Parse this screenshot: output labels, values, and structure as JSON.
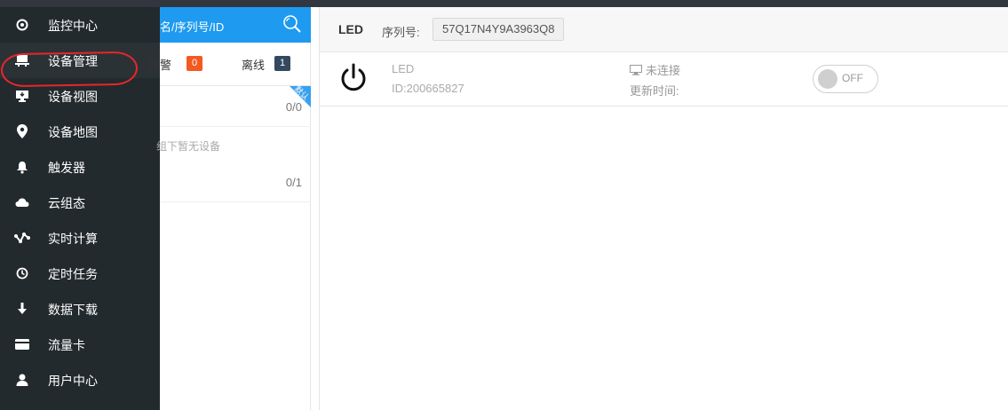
{
  "sidebar": {
    "items": [
      {
        "label": "监控中心",
        "icon": "target-icon"
      },
      {
        "label": "设备管理",
        "icon": "desk-icon"
      },
      {
        "label": "设备视图",
        "icon": "monitor-icon"
      },
      {
        "label": "设备地图",
        "icon": "map-pin-icon"
      },
      {
        "label": "触发器",
        "icon": "bell-icon"
      },
      {
        "label": "云组态",
        "icon": "cloud-icon"
      },
      {
        "label": "实时计算",
        "icon": "graph-icon"
      },
      {
        "label": "定时任务",
        "icon": "clock-icon"
      },
      {
        "label": "数据下载",
        "icon": "download-icon"
      },
      {
        "label": "流量卡",
        "icon": "card-icon"
      },
      {
        "label": "用户中心",
        "icon": "user-icon"
      }
    ],
    "active_index": 1,
    "annotation_color": "#e8262a"
  },
  "device_list": {
    "search_placeholder": "名/序列号/ID",
    "tabs": {
      "alarm_label": "报警",
      "alarm_count": "0",
      "offline_label": "离线",
      "offline_count": "1"
    },
    "groups": [
      {
        "tag": "默认",
        "count": "0/0"
      },
      {
        "empty_text": "组下暂无设备",
        "count": "0/1"
      }
    ],
    "accent_color": "#1e9af0"
  },
  "detail": {
    "device_name": "LED",
    "serial_label": "序列号:",
    "serial_value": "57Q17N4Y9A3963Q8",
    "row": {
      "name": "LED",
      "id": "ID:200665827",
      "status": "未连接",
      "update_label": "更新时间:",
      "switch_label": "OFF"
    }
  }
}
